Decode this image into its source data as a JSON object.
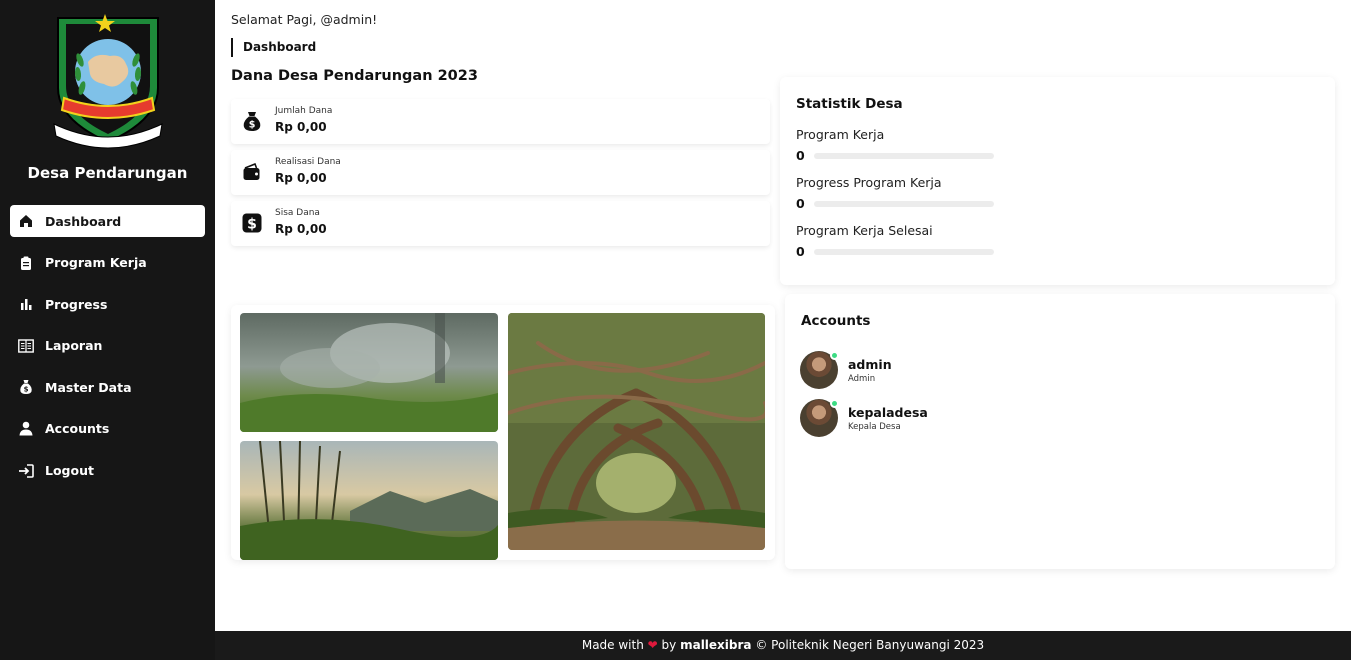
{
  "sidebar": {
    "village_name": "Desa Pendarungan",
    "logo_motto": "SATYA BHAKTI PRAJA MUKTI",
    "logo_banner": "BANYUWANGI",
    "items": [
      {
        "label": "Dashboard",
        "icon": "home-icon",
        "active": true
      },
      {
        "label": "Program Kerja",
        "icon": "clipboard-icon",
        "active": false
      },
      {
        "label": "Progress",
        "icon": "bar-chart-icon",
        "active": false
      },
      {
        "label": "Laporan",
        "icon": "report-icon",
        "active": false
      },
      {
        "label": "Master Data",
        "icon": "money-bag-icon",
        "active": false
      },
      {
        "label": "Accounts",
        "icon": "user-icon",
        "active": false
      },
      {
        "label": "Logout",
        "icon": "logout-icon",
        "active": false
      }
    ]
  },
  "header": {
    "greeting": "Selamat Pagi, @admin!",
    "breadcrumb": "Dashboard"
  },
  "funds": {
    "title": "Dana Desa Pendarungan 2023",
    "cards": [
      {
        "label": "Jumlah Dana",
        "value": "Rp 0,00",
        "icon": "money-bag-icon"
      },
      {
        "label": "Realisasi Dana",
        "value": "Rp 0,00",
        "icon": "wallet-icon"
      },
      {
        "label": "Sisa Dana",
        "value": "Rp 0,00",
        "icon": "dollar-icon"
      }
    ]
  },
  "stats": {
    "title": "Statistik Desa",
    "rows": [
      {
        "label": "Program Kerja",
        "value": "0",
        "fill": 0
      },
      {
        "label": "Progress Program Kerja",
        "value": "0",
        "fill": 0
      },
      {
        "label": "Program Kerja Selesai",
        "value": "0",
        "fill": 0
      }
    ]
  },
  "accounts": {
    "title": "Accounts",
    "users": [
      {
        "name": "admin",
        "role": "Admin",
        "online": true
      },
      {
        "name": "kepaladesa",
        "role": "Kepala Desa",
        "online": true
      }
    ]
  },
  "footer": {
    "made_with": "Made with",
    "by": "by",
    "author": "mallexibra",
    "copyright": "© Politeknik Negeri Banyuwangi 2023"
  },
  "colors": {
    "sidebar_bg": "#161616",
    "footer_bg": "#1a1a1a",
    "heart": "#e0193c",
    "online": "#3ddc84"
  }
}
